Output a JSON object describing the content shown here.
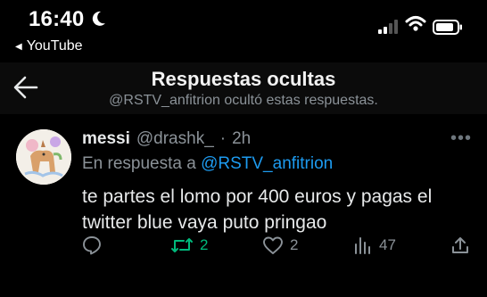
{
  "status_bar": {
    "time": "16:40",
    "back_app": "YouTube",
    "icons": [
      "moon-icon",
      "signal-icon",
      "wifi-icon",
      "battery-icon"
    ]
  },
  "header": {
    "title": "Respuestas ocultas",
    "subtitle": "@RSTV_anfitrion ocultó estas respuestas."
  },
  "tweet": {
    "name": "messi",
    "handle": "@drashk_",
    "separator": "·",
    "age": "2h",
    "reply_prefix": "En respuesta a",
    "reply_to": "@RSTV_anfitrion",
    "text": "te partes el lomo por 400 euros y pagas el twitter blue vaya puto pringao",
    "actions": {
      "replies": "",
      "retweets": "2",
      "likes": "2",
      "views": "47"
    }
  },
  "colors": {
    "background": "#000000",
    "accent": "#1d9bf0",
    "retweet": "#00ba7c",
    "muted": "#8b9298"
  }
}
